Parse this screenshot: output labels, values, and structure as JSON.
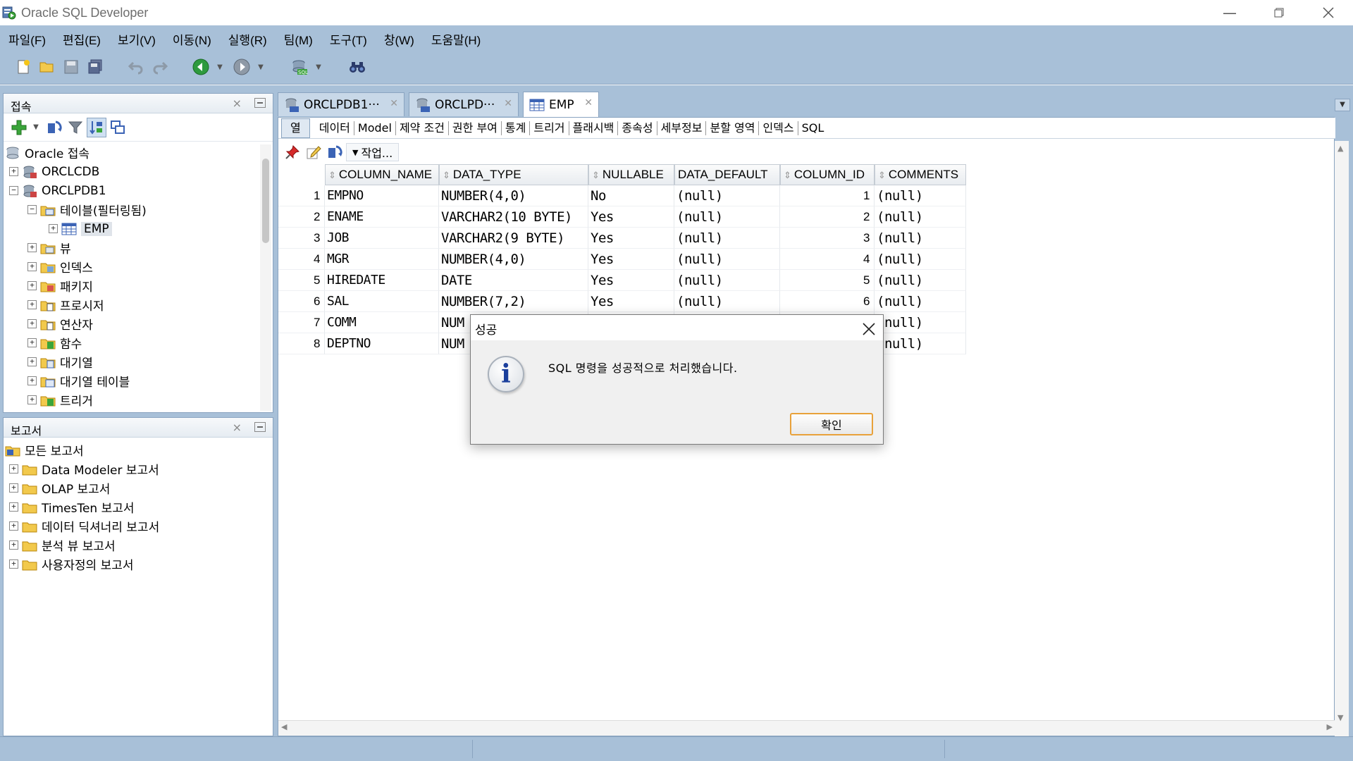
{
  "window": {
    "title": "Oracle SQL Developer"
  },
  "menu": [
    {
      "label": "파일(F)"
    },
    {
      "label": "편집(E)"
    },
    {
      "label": "보기(V)"
    },
    {
      "label": "이동(N)"
    },
    {
      "label": "실행(R)"
    },
    {
      "label": "팀(M)"
    },
    {
      "label": "도구(T)"
    },
    {
      "label": "창(W)"
    },
    {
      "label": "도움말(H)"
    }
  ],
  "connections_panel": {
    "title": "접속",
    "tree": [
      {
        "label": "Oracle 접속",
        "icon": "database-group-icon"
      },
      {
        "label": "ORCLCDB",
        "icon": "database-icon"
      },
      {
        "label": "ORCLPDB1",
        "icon": "database-icon"
      },
      {
        "label": "테이블(필터링됨)",
        "icon": "tables-folder-icon"
      },
      {
        "label": "EMP",
        "icon": "table-icon"
      },
      {
        "label": "뷰",
        "icon": "views-folder-icon"
      },
      {
        "label": "인덱스",
        "icon": "indexes-folder-icon"
      },
      {
        "label": "패키지",
        "icon": "packages-folder-icon"
      },
      {
        "label": "프로시저",
        "icon": "procedures-folder-icon"
      },
      {
        "label": "연산자",
        "icon": "operators-folder-icon"
      },
      {
        "label": "함수",
        "icon": "functions-folder-icon"
      },
      {
        "label": "대기열",
        "icon": "queues-folder-icon"
      },
      {
        "label": "대기열 테이블",
        "icon": "queue-tables-folder-icon"
      },
      {
        "label": "트리거",
        "icon": "triggers-folder-icon"
      }
    ]
  },
  "reports_panel": {
    "title": "보고서",
    "tree": [
      {
        "label": "모든 보고서"
      },
      {
        "label": "Data Modeler 보고서"
      },
      {
        "label": "OLAP 보고서"
      },
      {
        "label": "TimesTen 보고서"
      },
      {
        "label": "데이터 딕셔너리 보고서"
      },
      {
        "label": "분석 뷰 보고서"
      },
      {
        "label": "사용자정의 보고서"
      }
    ]
  },
  "doc_tabs": [
    {
      "label": "ORCLPDB1···"
    },
    {
      "label": "ORCLPD···"
    },
    {
      "label": "EMP"
    }
  ],
  "sub_tabs": [
    {
      "label": "열"
    },
    {
      "label": "데이터"
    },
    {
      "label": "Model"
    },
    {
      "label": "제약 조건"
    },
    {
      "label": "권한 부여"
    },
    {
      "label": "통계"
    },
    {
      "label": "트리거"
    },
    {
      "label": "플래시백"
    },
    {
      "label": "종속성"
    },
    {
      "label": "세부정보"
    },
    {
      "label": "분할 영역"
    },
    {
      "label": "인덱스"
    },
    {
      "label": "SQL"
    }
  ],
  "actions_label": "작업...",
  "grid": {
    "columns": [
      "COLUMN_NAME",
      "DATA_TYPE",
      "NULLABLE",
      "DATA_DEFAULT",
      "COLUMN_ID",
      "COMMENTS"
    ],
    "rows": [
      {
        "n": "1",
        "name": "EMPNO",
        "type": "NUMBER(4,0)",
        "nullable": "No",
        "default": "(null)",
        "id": "1",
        "comments": "(null)"
      },
      {
        "n": "2",
        "name": "ENAME",
        "type": "VARCHAR2(10 BYTE)",
        "nullable": "Yes",
        "default": "(null)",
        "id": "2",
        "comments": "(null)"
      },
      {
        "n": "3",
        "name": "JOB",
        "type": "VARCHAR2(9 BYTE)",
        "nullable": "Yes",
        "default": "(null)",
        "id": "3",
        "comments": "(null)"
      },
      {
        "n": "4",
        "name": "MGR",
        "type": "NUMBER(4,0)",
        "nullable": "Yes",
        "default": "(null)",
        "id": "4",
        "comments": "(null)"
      },
      {
        "n": "5",
        "name": "HIREDATE",
        "type": "DATE",
        "nullable": "Yes",
        "default": "(null)",
        "id": "5",
        "comments": "(null)"
      },
      {
        "n": "6",
        "name": "SAL",
        "type": "NUMBER(7,2)",
        "nullable": "Yes",
        "default": "(null)",
        "id": "6",
        "comments": "(null)"
      },
      {
        "n": "7",
        "name": "COMM",
        "type": "NUM",
        "nullable": "",
        "default": "",
        "id": "",
        "comments": "(null)"
      },
      {
        "n": "8",
        "name": "DEPTNO",
        "type": "NUM",
        "nullable": "",
        "default": "",
        "id": "",
        "comments": "(null)"
      }
    ]
  },
  "dialog": {
    "title": "성공",
    "message": "SQL 명령을 성공적으로 처리했습니다.",
    "ok_label": "확인"
  },
  "colors": {
    "chrome": "#a8c0d8",
    "ok_border": "#e8a13a",
    "info_icon": "#1b3f9c"
  }
}
